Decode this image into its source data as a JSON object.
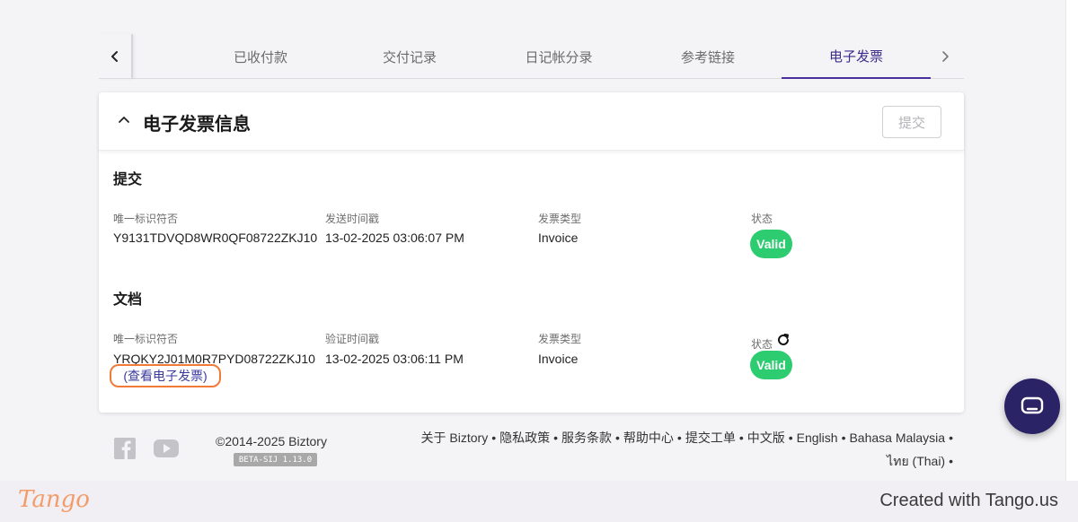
{
  "tabs": {
    "items": [
      {
        "label": "已收付款"
      },
      {
        "label": "交付记录"
      },
      {
        "label": "日记帐分录"
      },
      {
        "label": "参考链接"
      },
      {
        "label": "电子发票"
      }
    ],
    "active_index": 4
  },
  "card": {
    "title": "电子发票信息",
    "submit_label": "提交",
    "submission": {
      "section_title": "提交",
      "uid_label": "唯一标识符否",
      "uid_value": "Y9131TDVQD8WR0QF08722ZKJ10",
      "time_label": "发送时间戳",
      "time_value": "13-02-2025 03:06:07 PM",
      "type_label": "发票类型",
      "type_value": "Invoice",
      "status_label": "状态",
      "status_value": "Valid"
    },
    "document": {
      "section_title": "文档",
      "uid_label": "唯一标识符否",
      "uid_value": "YRQKY2J01M0R7PYD08722ZKJ10",
      "view_link": "(查看电子发票)",
      "time_label": "验证时间戳",
      "time_value": "13-02-2025 03:06:11 PM",
      "type_label": "发票类型",
      "type_value": "Invoice",
      "status_label": "状态",
      "status_value": "Valid"
    }
  },
  "footer": {
    "copyright": "©2014-2025 Biztory",
    "version": "BETA-SIJ 1.13.0",
    "links": [
      "关于 Biztory",
      "隐私政策",
      "服务条款",
      "帮助中心",
      "提交工单",
      "中文版",
      "English",
      "Bahasa Malaysia",
      "ไทย (Thai)"
    ],
    "separator": "•"
  },
  "tango": {
    "logo": "Tango",
    "credit": "Created with Tango.us"
  },
  "colors": {
    "accent": "#4a2f9e",
    "valid": "#2ecc71",
    "highlight": "#f07a36",
    "chat": "#2a2366"
  },
  "icons": [
    "chevron-left-icon",
    "chevron-right-icon",
    "chevron-up-icon",
    "refresh-icon",
    "facebook-icon",
    "youtube-icon",
    "chat-icon"
  ]
}
